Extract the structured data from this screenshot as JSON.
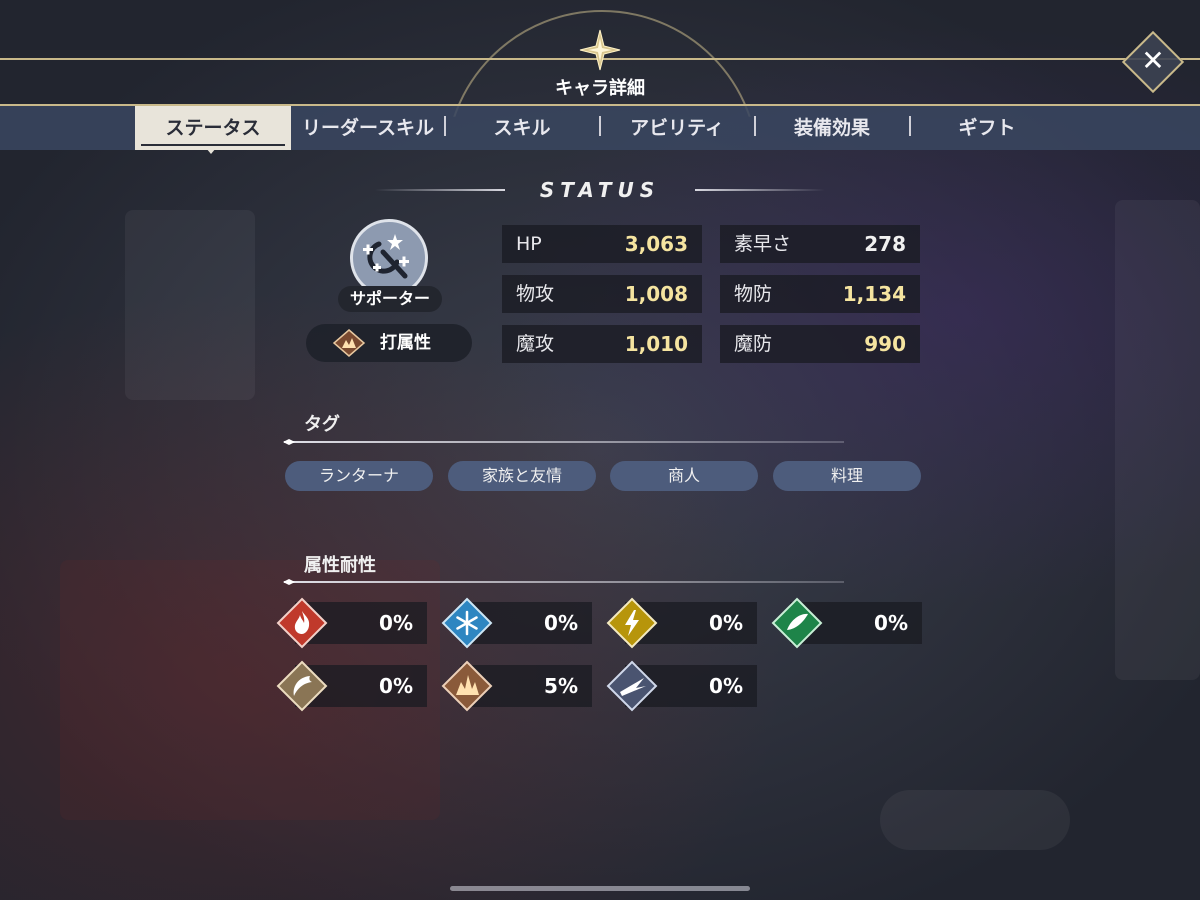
{
  "header": {
    "title": "キャラ詳細",
    "close_label": "✕"
  },
  "tabs": [
    {
      "label": "ステータス"
    },
    {
      "label": "リーダースキル"
    },
    {
      "label": "スキル"
    },
    {
      "label": "アビリティ"
    },
    {
      "label": "装備効果"
    },
    {
      "label": "ギフト"
    }
  ],
  "status": {
    "heading": "STATUS",
    "role": "サポーター",
    "attribute": "打属性",
    "stats": [
      {
        "label": "HP",
        "value": "3,063"
      },
      {
        "label": "素早さ",
        "value": "278"
      },
      {
        "label": "物攻",
        "value": "1,008"
      },
      {
        "label": "物防",
        "value": "1,134"
      },
      {
        "label": "魔攻",
        "value": "1,010"
      },
      {
        "label": "魔防",
        "value": "990"
      }
    ]
  },
  "tags_section": {
    "label": "タグ",
    "tags": [
      "ランターナ",
      "家族と友情",
      "商人",
      "料理"
    ]
  },
  "resistance_section": {
    "label": "属性耐性",
    "items": [
      {
        "icon": "fire-icon",
        "color": "#c0392b",
        "value": "0%"
      },
      {
        "icon": "ice-icon",
        "color": "#2e86c1",
        "value": "0%"
      },
      {
        "icon": "thunder-icon",
        "color": "#b7950b",
        "value": "0%"
      },
      {
        "icon": "wind-icon",
        "color": "#1e8449",
        "value": "0%"
      },
      {
        "icon": "slash-icon",
        "color": "#8a7555",
        "value": "0%"
      },
      {
        "icon": "blunt-icon",
        "color": "#8a5a3a",
        "value": "5%"
      },
      {
        "icon": "pierce-icon",
        "color": "#4a5470",
        "value": "0%"
      }
    ]
  },
  "colors": {
    "accent_gold": "#c9b98a",
    "value_yellow": "#f5e4a0",
    "tag_bg": "#4d5c7c"
  }
}
